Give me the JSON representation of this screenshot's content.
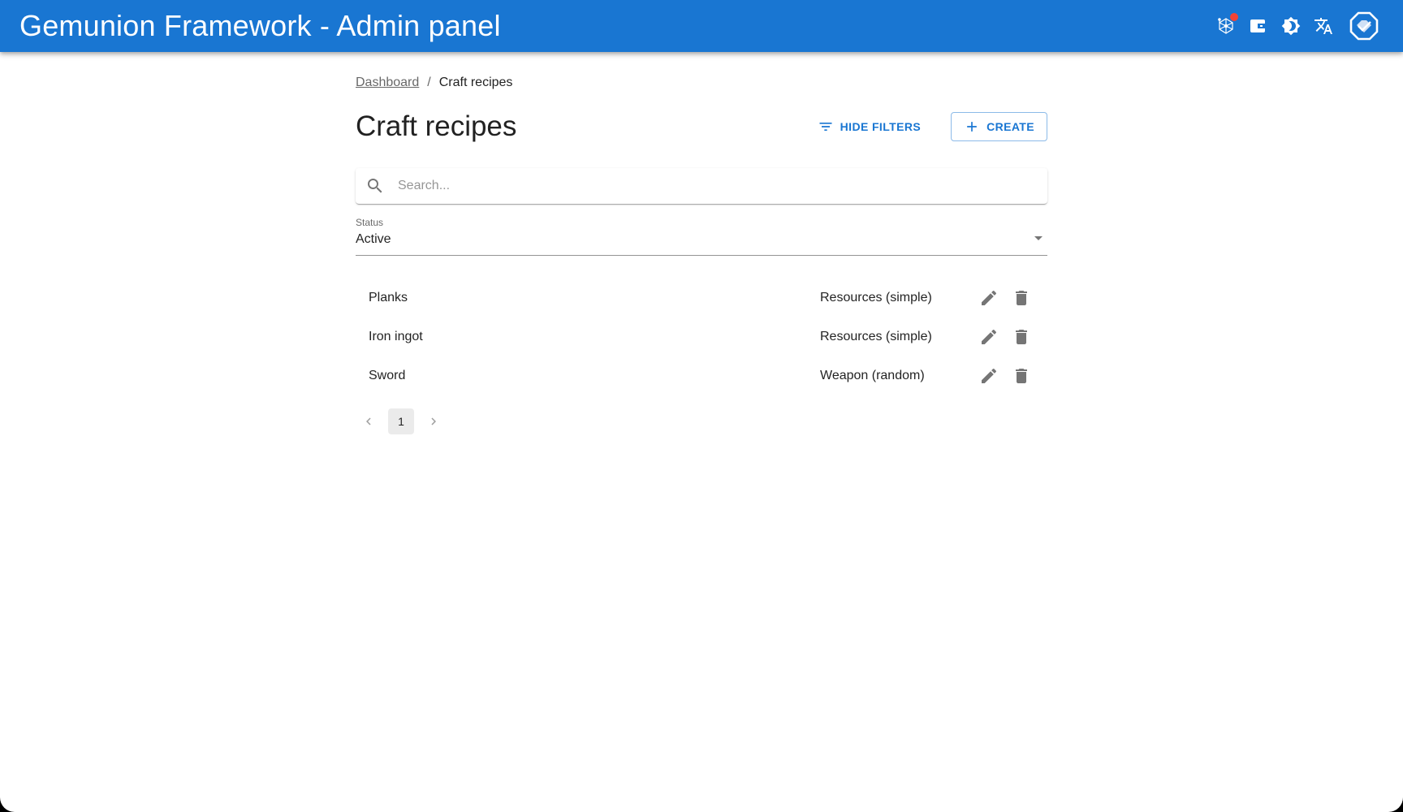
{
  "app": {
    "title": "Gemunion Framework - Admin panel",
    "colors": {
      "primary": "#1976d2",
      "badge": "#f44336",
      "icon_gray": "#757575"
    },
    "header_icons": [
      {
        "name": "network-icon",
        "has_badge": true
      },
      {
        "name": "wallet-icon",
        "has_badge": false
      },
      {
        "name": "theme-toggle-icon",
        "has_badge": false
      },
      {
        "name": "translate-icon",
        "has_badge": false
      },
      {
        "name": "avatar-icon",
        "has_badge": false
      }
    ]
  },
  "breadcrumb": {
    "items": [
      "Dashboard",
      "Craft recipes"
    ],
    "separator": "/"
  },
  "page": {
    "title": "Craft recipes",
    "actions": {
      "hide_filters": "Hide filters",
      "create": "Create"
    }
  },
  "search": {
    "value": "",
    "placeholder": "Search..."
  },
  "filters": {
    "status": {
      "label": "Status",
      "value": "Active"
    }
  },
  "recipes": [
    {
      "name": "Planks",
      "type": "Resources (simple)"
    },
    {
      "name": "Iron ingot",
      "type": "Resources (simple)"
    },
    {
      "name": "Sword",
      "type": "Weapon (random)"
    }
  ],
  "pagination": {
    "current_page": "1",
    "prev": "previous-page",
    "next": "next-page"
  }
}
